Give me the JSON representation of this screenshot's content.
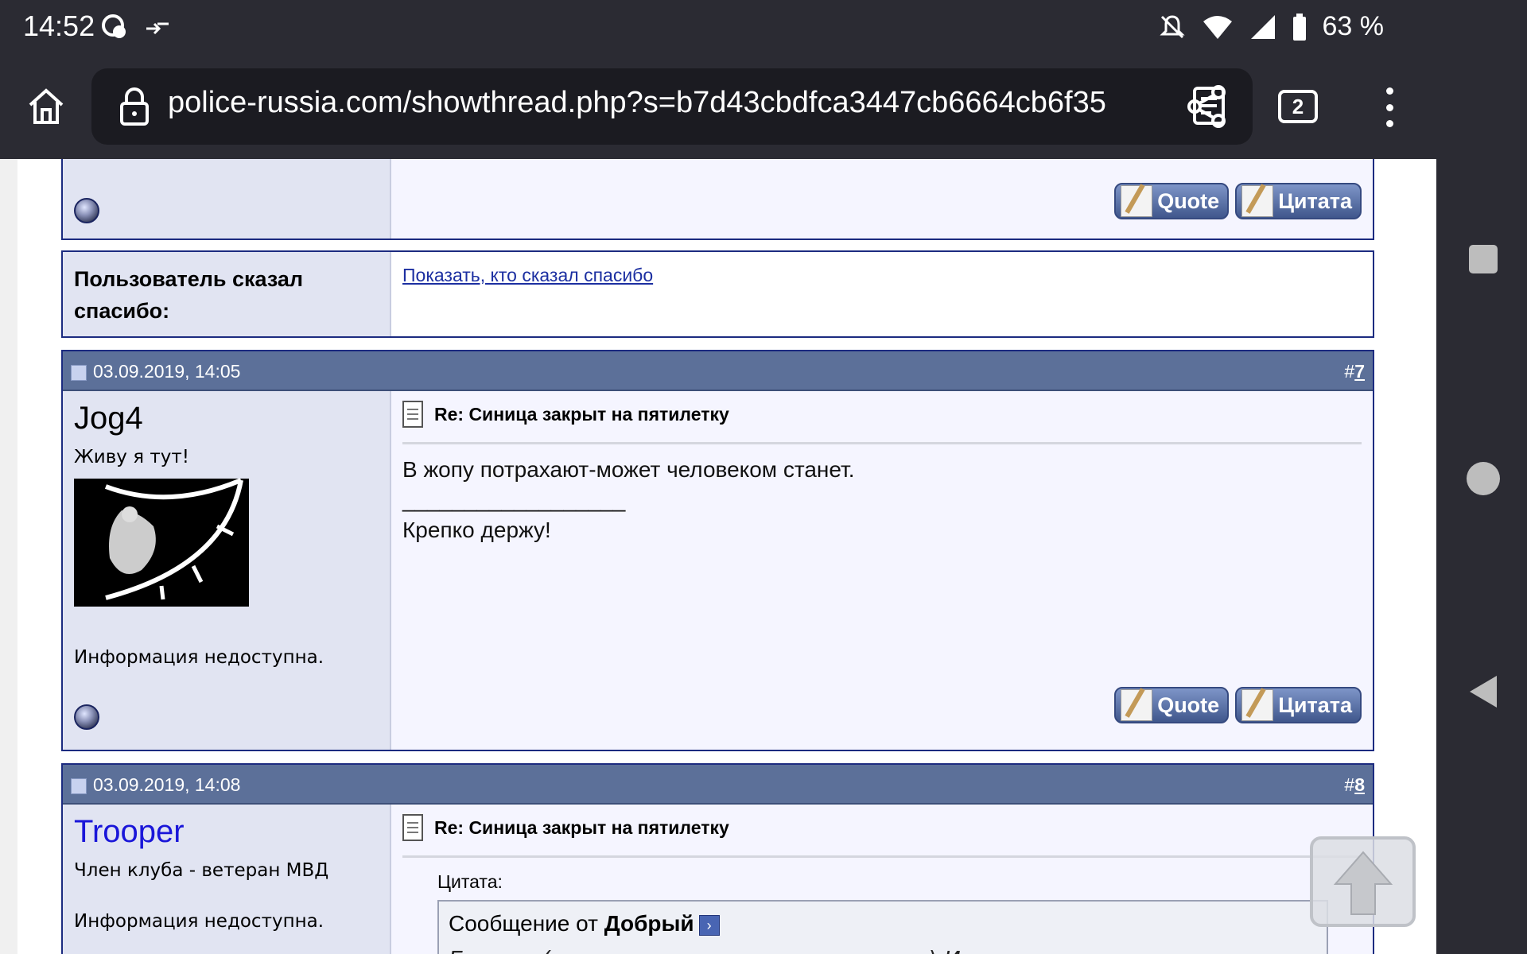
{
  "status": {
    "time": "14:52",
    "battery": "63 %"
  },
  "browser": {
    "url": "police-russia.com/showthread.php?s=b7d43cbdfca3447cb6664cb6f35",
    "tab_count": "2"
  },
  "thanks": {
    "label": "Пользователь сказал спасибо:",
    "link": "Показать, кто сказал спасибо"
  },
  "buttons": {
    "quick_quote": "Quote",
    "quote": "Цитата"
  },
  "posts": [
    {
      "date": "03.09.2019, 14:05",
      "number_prefix": "#",
      "number": "7",
      "username": "Jog4",
      "user_title": "Живу я тут!",
      "info": "Информация недоступна.",
      "title": "Re: Синица закрыт на пятилетку",
      "body_line1": "В жопу потрахают-может человеком станет.",
      "signature_sep": "__________________",
      "signature": "Крепко держу!"
    },
    {
      "date": "03.09.2019, 14:08",
      "number_prefix": "#",
      "number": "8",
      "username": "Trooper",
      "user_title": "Член клуба - ветеран МВД",
      "info": "Информация недоступна.",
      "title": "Re: Синица закрыт на пятилетку",
      "quote_label": "Цитата:",
      "quote_from_prefix": "Сообщение от",
      "quote_author": "Добрый",
      "quote_text": "Быстро (с учетом экспертиз - мгновенно) И много"
    }
  ]
}
